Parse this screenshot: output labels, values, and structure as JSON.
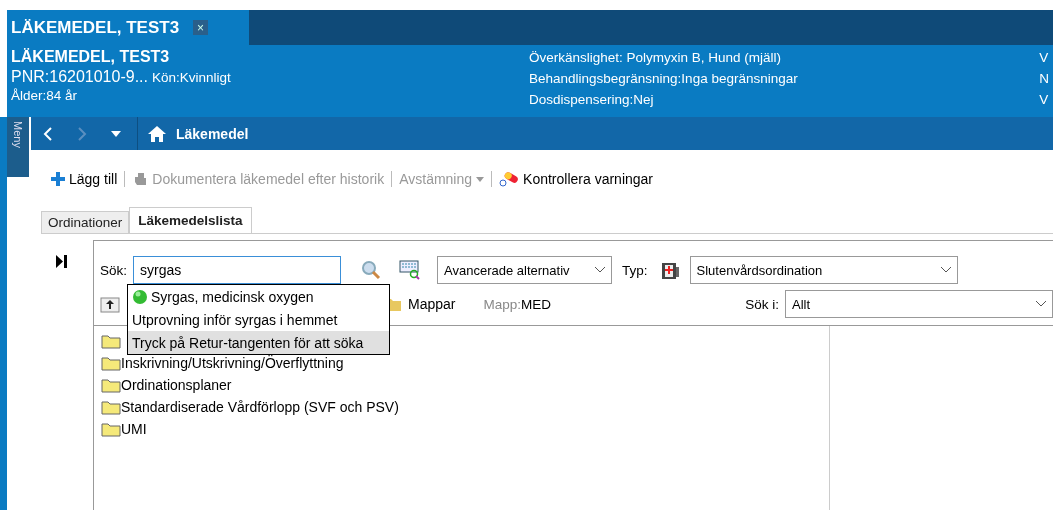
{
  "patient_tab": {
    "title": "LÄKEMEDEL, TEST3",
    "close": "×"
  },
  "patient": {
    "name": "LÄKEMEDEL, TEST3",
    "pnr": "PNR:16201010-9...",
    "gender": "Kön:Kvinnligt",
    "age": "Ålder:84 år",
    "details": [
      "Överkänslighet: Polymyxin B, Hund (mjäll)",
      "Behandlingsbegränsning:Inga begränsningar",
      "Dosdispensering:Nej"
    ],
    "column_3": [
      "V",
      "N",
      "V"
    ]
  },
  "side_menu": {
    "label": "Meny"
  },
  "nav": {
    "title": "Läkemedel"
  },
  "toolbar": [
    {
      "kind": "add",
      "label": "Lägg till",
      "disabled": false
    },
    {
      "kind": "document",
      "label": "Dokumentera läkemedel efter historik",
      "disabled": true
    },
    {
      "kind": "dropdown",
      "label": "Avstämning",
      "disabled": true
    },
    {
      "kind": "warning",
      "label": "Kontrollera varningar",
      "disabled": false
    }
  ],
  "tabs": [
    {
      "label": "Ordinationer",
      "selected": false
    },
    {
      "label": "Läkemedelslista",
      "selected": true
    }
  ],
  "search": {
    "label": "Sök:",
    "value": "syrgas"
  },
  "suggestions": [
    {
      "kind": "drug",
      "label": "Syrgas, medicinsk oxygen",
      "selected": false
    },
    {
      "kind": "text",
      "label": "Utprovning inför syrgas i hemmet",
      "selected": false
    },
    {
      "kind": "text",
      "label": "Tryck på Retur-tangenten för att söka",
      "selected": true
    }
  ],
  "options": {
    "value": "Avancerade alternativ"
  },
  "type": {
    "label": "Typ:",
    "value": "Slutenvårdsordination"
  },
  "folders": {
    "label": "Mappar",
    "mapp_label": "Mapp:",
    "mapp_value": "MED"
  },
  "search_in": {
    "label": "Sök i:",
    "value": "Allt"
  },
  "tree": [
    {
      "kind": "covered"
    },
    {
      "kind": "folder",
      "label": "Inskrivning/Utskrivning/Överflyttning"
    },
    {
      "kind": "folder",
      "label": "Ordinationsplaner"
    },
    {
      "kind": "folder",
      "label": "Standardiserade Vårdförlopp (SVF och PSV)"
    },
    {
      "kind": "folder",
      "label": "UMI"
    }
  ]
}
